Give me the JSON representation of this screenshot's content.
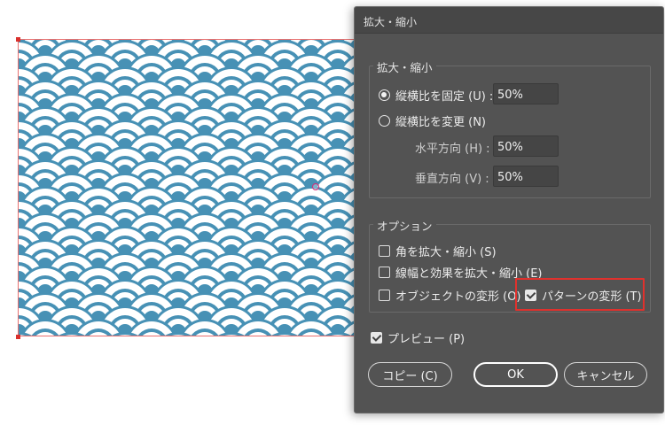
{
  "dialog": {
    "title": "拡大・縮小",
    "scale_group": {
      "legend": "拡大・縮小",
      "uniform_label": "縦横比を固定 (U) :",
      "uniform_value": "50%",
      "uniform_selected": true,
      "nonuniform_label": "縦横比を変更 (N)",
      "nonuniform_selected": false,
      "horizontal_label": "水平方向 (H) :",
      "horizontal_value": "50%",
      "vertical_label": "垂直方向 (V) :",
      "vertical_value": "50%"
    },
    "options_group": {
      "legend": "オプション",
      "scale_corners_label": "角を拡大・縮小 (S)",
      "scale_corners_checked": false,
      "scale_strokes_label": "線幅と効果を拡大・縮小 (E)",
      "scale_strokes_checked": false,
      "transform_objects_label": "オブジェクトの変形 (O)",
      "transform_objects_checked": false,
      "transform_patterns_label": "パターンの変形 (T)",
      "transform_patterns_checked": true
    },
    "preview_label": "プレビュー (P)",
    "preview_checked": true,
    "buttons": {
      "copy": "コピー (C)",
      "ok": "OK",
      "cancel": "キャンセル"
    }
  },
  "artboard": {
    "pattern_name": "seigaiha-wave-pattern",
    "pattern_color": "#4791b5",
    "arc_color": "#ffffff"
  },
  "colors": {
    "dialog_bg": "#535353",
    "highlight": "#e0312d",
    "selection": "#d9302c"
  }
}
